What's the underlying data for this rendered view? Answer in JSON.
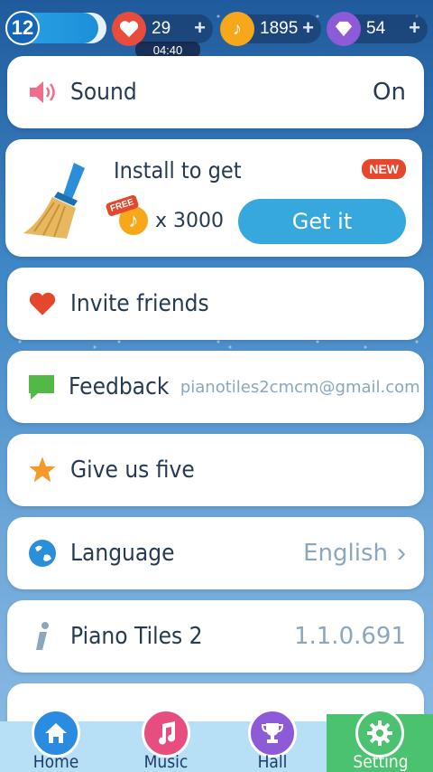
{
  "colors": {
    "accent": "#37a8de",
    "new_badge": "#e4472c",
    "active_tab": "#4bc26f",
    "heart": "#e74c3c",
    "coin": "#f6a81a",
    "gem": "#8e5bd8",
    "label": "#263a52",
    "value": "#8aa7bd"
  },
  "status": {
    "level": "12",
    "level_progress": 0.92,
    "lives": "29",
    "lives_timer": "04:40",
    "coins": "1895",
    "gems": "54",
    "plus": "+"
  },
  "sound": {
    "label": "Sound",
    "value": "On",
    "icon": "speaker-icon"
  },
  "install_offer": {
    "title": "Install to get",
    "badge": "NEW",
    "free_badge": "FREE",
    "reward_amount": "x 3000",
    "button_label": "Get it",
    "icon": "broom-icon"
  },
  "menu": {
    "invite": {
      "label": "Invite friends",
      "icon": "heart-icon"
    },
    "feedback": {
      "label": "Feedback",
      "value": "pianotiles2cmcm@gmail.com",
      "icon": "chat-icon"
    },
    "rate": {
      "label": "Give us five",
      "icon": "star-icon"
    },
    "language": {
      "label": "Language",
      "value": "English",
      "icon": "globe-icon",
      "chevron": "›"
    },
    "about": {
      "label": "Piano Tiles 2",
      "value": "1.1.0.691",
      "icon": "info-icon"
    }
  },
  "nav": [
    {
      "label": "Home",
      "icon": "home-icon"
    },
    {
      "label": "Music",
      "icon": "music-note-icon"
    },
    {
      "label": "Hall",
      "icon": "trophy-icon"
    },
    {
      "label": "Setting",
      "icon": "gear-icon"
    }
  ]
}
